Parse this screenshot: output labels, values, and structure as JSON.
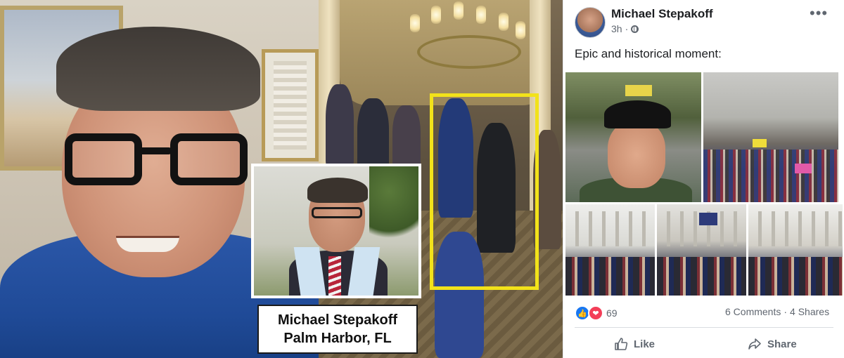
{
  "caption": {
    "name_line": "Michael Stepakoff",
    "location_line": "Palm Harbor, FL"
  },
  "post": {
    "author": "Michael Stepakoff",
    "time": "3h",
    "privacy_icon": "globe-icon",
    "more_label": "•••",
    "text": "Epic and historical moment:",
    "reactions": {
      "icons": [
        "like-reaction-icon",
        "love-reaction-icon"
      ],
      "count": "69"
    },
    "stats": {
      "comments": "6 Comments",
      "separator": "·",
      "shares": "4 Shares"
    },
    "actions": {
      "like_label": "Like",
      "share_label": "Share"
    }
  },
  "colors": {
    "highlight_box": "#f2e21a",
    "facebook_blue": "#1877f2",
    "love_red": "#f33e58",
    "meta_gray": "#606770"
  }
}
